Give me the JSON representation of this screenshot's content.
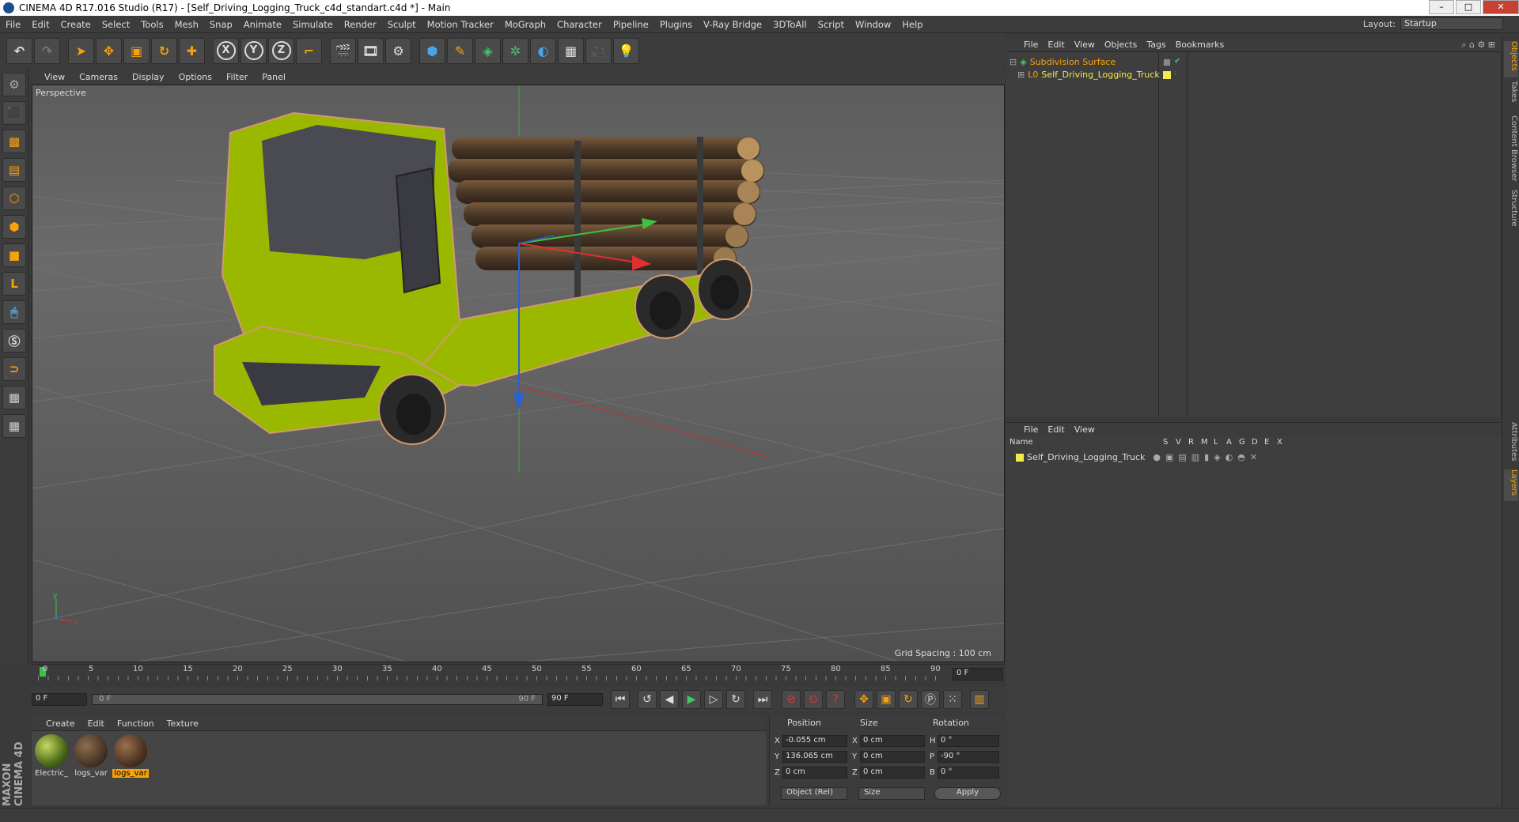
{
  "window": {
    "title": "CINEMA 4D R17.016 Studio (R17) - [Self_Driving_Logging_Truck_c4d_standart.c4d *] - Main",
    "min": "–",
    "max": "□",
    "close": "✕"
  },
  "menu": [
    "File",
    "Edit",
    "Create",
    "Select",
    "Tools",
    "Mesh",
    "Snap",
    "Animate",
    "Simulate",
    "Render",
    "Sculpt",
    "Motion Tracker",
    "MoGraph",
    "Character",
    "Pipeline",
    "Plugins",
    "V-Ray Bridge",
    "3DToAll",
    "Script",
    "Window",
    "Help"
  ],
  "layout": {
    "label": "Layout:",
    "value": "Startup"
  },
  "toolbar": {
    "undo": "↶",
    "redo": "↷",
    "x": "X",
    "y": "Y",
    "z": "Z"
  },
  "viewport": {
    "menu": [
      "View",
      "Cameras",
      "Display",
      "Options",
      "Filter",
      "Panel"
    ],
    "camera": "Perspective",
    "grid_spacing": "Grid Spacing : 100 cm"
  },
  "timeline": {
    "ticks": [
      "0",
      "5",
      "10",
      "15",
      "20",
      "25",
      "30",
      "35",
      "40",
      "45",
      "50",
      "55",
      "60",
      "65",
      "70",
      "75",
      "80",
      "85",
      "90"
    ],
    "current_frame": "0 F",
    "start": "0 F",
    "range_start": "0 F",
    "range_end": "90 F",
    "end": "90 F"
  },
  "materials": {
    "menu": [
      "Create",
      "Edit",
      "Function",
      "Texture"
    ],
    "items": [
      {
        "name": "Electric_",
        "color": "#6f8a2a"
      },
      {
        "name": "logs_var",
        "color": "#5a4432"
      },
      {
        "name": "logs_var",
        "color": "#5e4030"
      }
    ]
  },
  "coordinates": {
    "headers": {
      "position": "Position",
      "size": "Size",
      "rotation": "Rotation"
    },
    "rows": [
      {
        "axis": "X",
        "pos": "-0.055 cm",
        "size_axis": "X",
        "size": "0 cm",
        "rot_axis": "H",
        "rot": "0 °"
      },
      {
        "axis": "Y",
        "pos": "136.065 cm",
        "size_axis": "Y",
        "size": "0 cm",
        "rot_axis": "P",
        "rot": "-90 °"
      },
      {
        "axis": "Z",
        "pos": "0 cm",
        "size_axis": "Z",
        "size": "0 cm",
        "rot_axis": "B",
        "rot": "0 °"
      }
    ],
    "mode": "Object (Rel)",
    "size_mode": "Size",
    "apply": "Apply"
  },
  "object_manager": {
    "menu": [
      "File",
      "Edit",
      "View",
      "Objects",
      "Tags",
      "Bookmarks"
    ],
    "items": [
      {
        "name": "Subdivision Surface"
      },
      {
        "name": "Self_Driving_Logging_Truck"
      }
    ]
  },
  "layer_manager": {
    "menu": [
      "File",
      "Edit",
      "View"
    ],
    "columns": [
      "Name",
      "S",
      "V",
      "R",
      "M",
      "L",
      "A",
      "G",
      "D",
      "E",
      "X"
    ],
    "layer_name": "Self_Driving_Logging_Truck"
  },
  "right_tabs": [
    "Objects",
    "Takes",
    "Content Browser",
    "Structure",
    "Attributes",
    "Layers"
  ],
  "brand": "MAXON CINEMA 4D",
  "colors": {
    "accent": "#f7a10b",
    "truck_body": "#9bb800",
    "layer_yellow": "#f2e94e"
  }
}
